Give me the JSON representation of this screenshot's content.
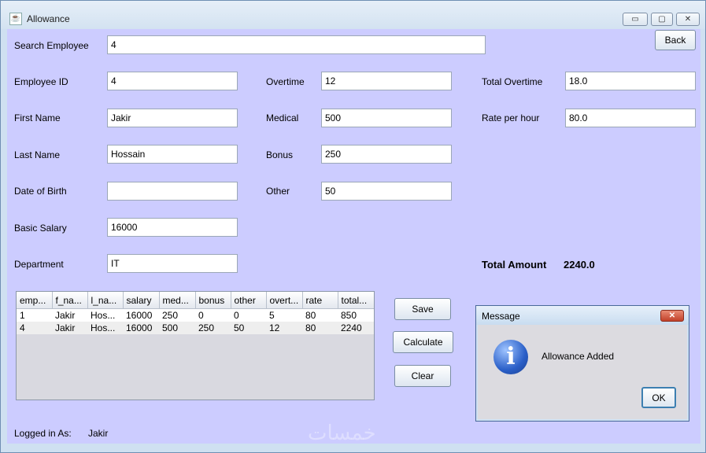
{
  "window": {
    "title": "Allowance",
    "app_icon": "java-icon",
    "minimize_icon": "minimize-icon",
    "maximize_icon": "maximize-icon",
    "close_icon": "close-icon",
    "back_label": "Back"
  },
  "search": {
    "label": "Search Employee",
    "value": "4"
  },
  "employee": {
    "id_label": "Employee ID",
    "id_value": "4",
    "first_label": "First Name",
    "first_value": "Jakir",
    "last_label": "Last Name",
    "last_value": "Hossain",
    "dob_label": "Date of Birth",
    "dob_value": "",
    "salary_label": "Basic Salary",
    "salary_value": "16000",
    "dept_label": "Department",
    "dept_value": "IT"
  },
  "allowance": {
    "overtime_label": "Overtime",
    "overtime_value": "12",
    "medical_label": "Medical",
    "medical_value": "500",
    "bonus_label": "Bonus",
    "bonus_value": "250",
    "other_label": "Other",
    "other_value": "50"
  },
  "totals": {
    "total_overtime_label": "Total Overtime",
    "total_overtime_value": "18.0",
    "rate_label": "Rate per hour",
    "rate_value": "80.0",
    "amount_label": "Total Amount",
    "amount_value": "2240.0"
  },
  "table": {
    "columns": [
      "emp...",
      "f_na...",
      "l_na...",
      "salary",
      "med...",
      "bonus",
      "other",
      "overt...",
      "rate",
      "total..."
    ],
    "rows": [
      [
        "1",
        "Jakir",
        "Hos...",
        "16000",
        "250",
        "0",
        "0",
        "5",
        "80",
        "850"
      ],
      [
        "4",
        "Jakir",
        "Hos...",
        "16000",
        "500",
        "250",
        "50",
        "12",
        "80",
        "2240"
      ]
    ]
  },
  "buttons": {
    "save": "Save",
    "calculate": "Calculate",
    "clear": "Clear"
  },
  "status": {
    "logged_label": "Logged in As:",
    "user": "Jakir"
  },
  "dialog": {
    "title": "Message",
    "message": "Allowance Added",
    "ok": "OK",
    "close_glyph": "✕",
    "icon": "info-icon"
  },
  "watermark": "خمسات"
}
